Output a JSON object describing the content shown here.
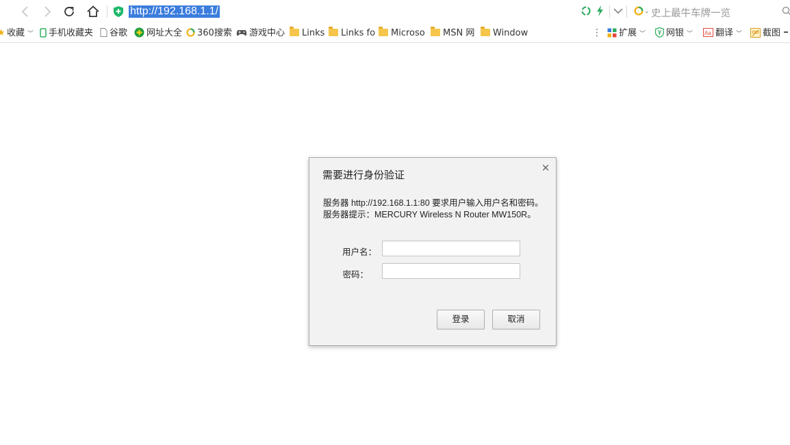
{
  "browser": {
    "url": "http://192.168.1.1/",
    "search_hint": "史上最牛车牌一览",
    "colors": {
      "url_highlight": "#3b7ddd",
      "shield": "#1fb86b"
    }
  },
  "bookmarks": [
    {
      "label": "收藏",
      "icon": "star-icon",
      "caret": "﹀"
    },
    {
      "label": "手机收藏夹",
      "icon": "phone-icon"
    },
    {
      "label": "谷歌",
      "icon": "page-icon"
    },
    {
      "label": "网址大全",
      "icon": "plus-circle-icon"
    },
    {
      "label": "360搜索",
      "icon": "so-icon"
    },
    {
      "label": "游戏中心",
      "icon": "gamepad-icon"
    },
    {
      "label": "Links",
      "icon": "folder-icon"
    },
    {
      "label": "Links fo",
      "icon": "folder-icon"
    },
    {
      "label": "Microso",
      "icon": "folder-icon"
    },
    {
      "label": "MSN 网",
      "icon": "folder-icon"
    },
    {
      "label": "Window",
      "icon": "folder-icon"
    }
  ],
  "extensions": [
    {
      "label": "扩展",
      "icon": "grid-icon"
    },
    {
      "label": "网银",
      "icon": "shield-yen-icon"
    },
    {
      "label": "翻译",
      "icon": "translate-icon"
    },
    {
      "label": "截图",
      "icon": "screenshot-icon"
    }
  ],
  "dialog": {
    "title": "需要进行身份验证",
    "line1": "服务器 http://192.168.1.1:80 要求用户输入用户名和密码。",
    "line2": "服务器提示：MERCURY Wireless N Router MW150R。",
    "username_label": "用户名：",
    "password_label": "密码：",
    "username_value": "",
    "password_value": "",
    "login_label": "登录",
    "cancel_label": "取消",
    "close_glyph": "×"
  }
}
